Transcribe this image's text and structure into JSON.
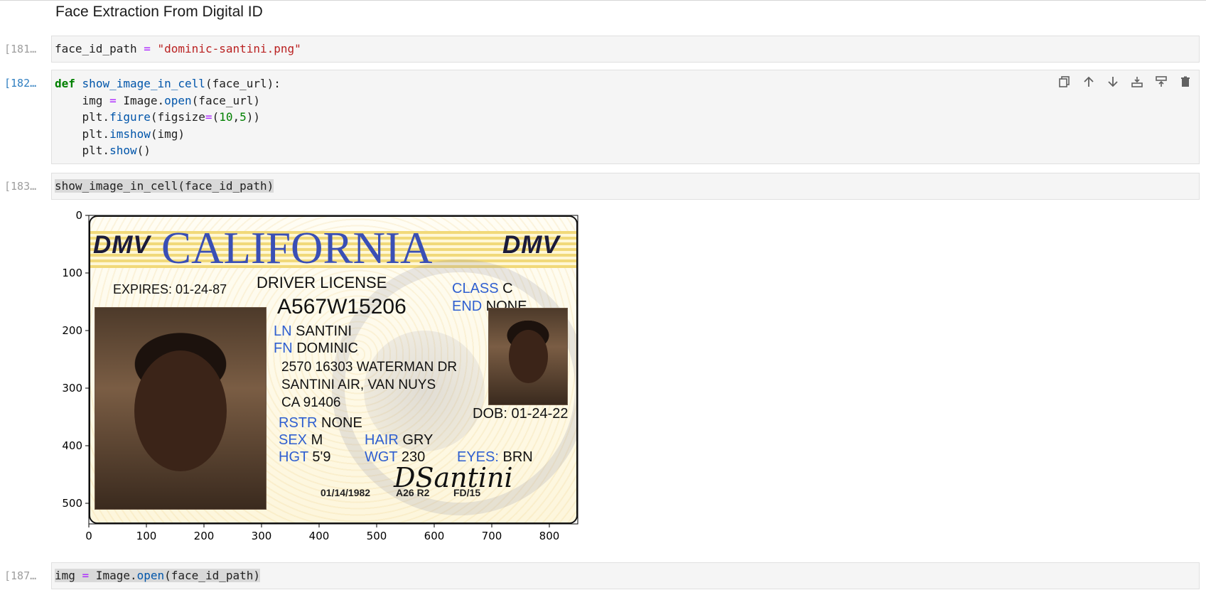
{
  "notebook": {
    "heading": "Face Extraction From Digital ID",
    "cells": [
      {
        "prompt": "[181…",
        "code_var": "face_id_path",
        "code_op": "=",
        "code_str": "\"dominic-santini.png\""
      },
      {
        "prompt": "[182…",
        "lines": {
          "l1_kw": "def",
          "l1_fn": "show_image_in_cell",
          "l1_rest": "(face_url):",
          "l2_a": "    img ",
          "l2_op": "=",
          "l2_b": " Image.",
          "l2_fn": "open",
          "l2_c": "(face_url)",
          "l3_a": "    plt.",
          "l3_fn": "figure",
          "l3_b": "(figsize",
          "l3_op": "=",
          "l3_c": "(",
          "l3_n1": "10",
          "l3_d": ",",
          "l3_n2": "5",
          "l3_e": "))",
          "l4_a": "    plt.",
          "l4_fn": "imshow",
          "l4_b": "(img)",
          "l5_a": "    plt.",
          "l5_fn": "show",
          "l5_b": "()"
        }
      },
      {
        "prompt": "[183…",
        "code": "show_image_in_cell(face_id_path)"
      },
      {
        "prompt": "[187…",
        "code_a": "img ",
        "code_op": "=",
        "code_b": " Image.",
        "code_fn": "open",
        "code_c": "(face_id_path)"
      }
    ],
    "toolbar": [
      "duplicate-icon",
      "move-up-icon",
      "move-down-icon",
      "insert-above-icon",
      "insert-below-icon",
      "delete-icon"
    ]
  },
  "plot": {
    "xticks": [
      "0",
      "100",
      "200",
      "300",
      "400",
      "500",
      "600",
      "700",
      "800"
    ],
    "yticks": [
      "0",
      "100",
      "200",
      "300",
      "400",
      "500"
    ]
  },
  "id_card": {
    "dmv_left": "DMV",
    "state": "CALIFORNIA",
    "dmv_right": "DMV",
    "doc_type": "DRIVER LICENSE",
    "expires": "EXPIRES: 01-24-87",
    "license_no": "A567W15206",
    "class_label": "CLASS",
    "class_value": "C",
    "end_label": "END",
    "end_value": "NONE",
    "ln_label": "LN",
    "ln_value": "SANTINI",
    "fn_label": "FN",
    "fn_value": "DOMINIC",
    "address1": "2570 16303 WATERMAN DR",
    "address2": "SANTINI AIR, VAN NUYS",
    "address3": "CA 91406",
    "dob": "DOB: 01-24-22",
    "rstr_label": "RSTR",
    "rstr_value": "NONE",
    "sex_label": "SEX",
    "sex_value": "M",
    "hair_label": "HAIR",
    "hair_value": "GRY",
    "hgt_label": "HGT",
    "hgt_value": "5'9",
    "wgt_label": "WGT",
    "wgt_value": "230",
    "eyes_label": "EYES:",
    "eyes_value": "BRN",
    "signature": "DSantini",
    "foot1": "01/14/1982",
    "foot2": "A26 R2",
    "foot3": "FD/15"
  }
}
